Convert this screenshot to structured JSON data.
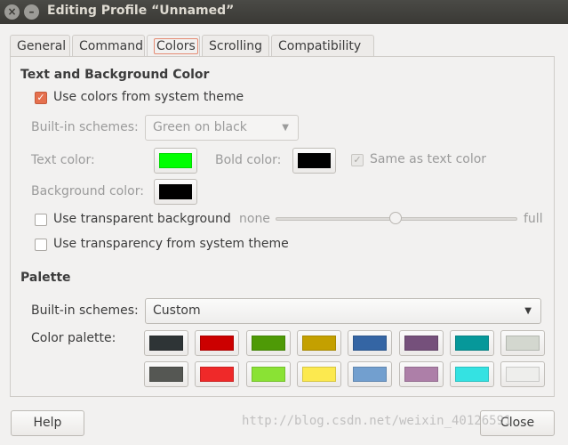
{
  "window": {
    "title": "Editing Profile “Unnamed”",
    "close_glyph": "×",
    "min_glyph": "–"
  },
  "tabs": [
    {
      "label": "General"
    },
    {
      "label": "Command"
    },
    {
      "label": "Colors"
    },
    {
      "label": "Scrolling"
    },
    {
      "label": "Compatibility"
    }
  ],
  "text_bg": {
    "heading": "Text and Background Color",
    "use_system_theme": {
      "label": "Use colors from system theme",
      "checked": true
    },
    "builtin_label": "Built-in schemes:",
    "builtin_value": "Green on black",
    "text_color_label": "Text color:",
    "text_color": "#00ff00",
    "bold_color_label": "Bold color:",
    "bold_color": "#000000",
    "same_as_text": {
      "label": "Same as text color",
      "checked": true
    },
    "bg_color_label": "Background color:",
    "bg_color": "#000000",
    "transparent_bg": {
      "label": "Use transparent background",
      "checked": false
    },
    "slider_min": "none",
    "slider_max": "full",
    "transparency_system": {
      "label": "Use transparency from system theme",
      "checked": false
    }
  },
  "palette": {
    "heading": "Palette",
    "builtin_label": "Built-in schemes:",
    "builtin_value": "Custom",
    "palette_label": "Color palette:",
    "colors": [
      "#2e3436",
      "#cc0000",
      "#4e9a06",
      "#c4a000",
      "#3465a4",
      "#75507b",
      "#06989a",
      "#d3d7cf",
      "#555753",
      "#ef2929",
      "#8ae234",
      "#fce94f",
      "#729fcf",
      "#ad7fa8",
      "#34e2e2",
      "#eeeeec"
    ]
  },
  "buttons": {
    "help": "Help",
    "close": "Close"
  },
  "watermark": "http://blog.csdn.net/weixin_40126591"
}
